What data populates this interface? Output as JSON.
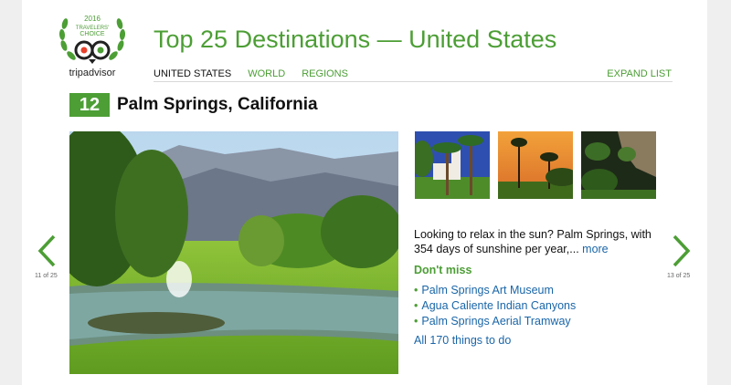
{
  "logo": {
    "year": "2016",
    "line1": "TRAVELERS'",
    "line2": "CHOICE",
    "brand": "tripadvisor"
  },
  "header": {
    "title": "Top 25 Destinations — United States"
  },
  "nav": {
    "items": [
      "UNITED STATES",
      "WORLD",
      "REGIONS"
    ],
    "expand": "EXPAND LIST"
  },
  "destination": {
    "rank": "12",
    "name": "Palm Springs, California"
  },
  "description": {
    "text": "Looking to relax in the sun? Palm Springs, with 354 days of sunshine per year,... ",
    "more": "more"
  },
  "dont_miss": {
    "heading": "Don't miss",
    "items": [
      "Palm Springs Art Museum",
      "Agua Caliente Indian Canyons",
      "Palm Springs Aerial Tramway"
    ],
    "all_link": "All 170 things to do"
  },
  "pager": {
    "prev": "11 of 25",
    "next": "13 of 25"
  },
  "icons": {
    "prev": "chevron-left-icon",
    "next": "chevron-right-icon",
    "logo": "owl-logo-icon"
  },
  "colors": {
    "brand_green": "#4c9e35",
    "link_blue": "#1a66a8"
  }
}
